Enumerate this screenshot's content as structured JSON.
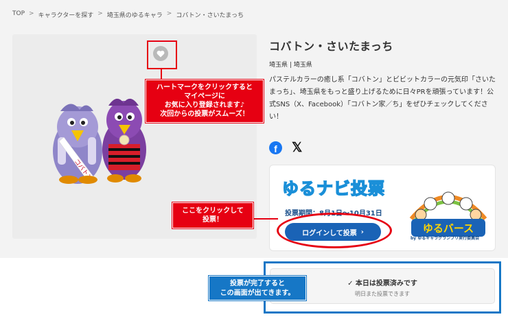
{
  "breadcrumb": [
    "TOP",
    "キャラクターを探す",
    "埼玉県のゆるキャラ",
    "コバトン・さいたまっち"
  ],
  "breadcrumb_separator": ">",
  "character": {
    "name": "コバトン・さいたまっち",
    "prefecture": "埼玉県 | 埼玉県",
    "description": "パステルカラーの癒し系「コバトン」とビビットカラーの元気印「さいたまっち」、埼玉県をもっと盛り上げるために日々PRを頑張っています！公式SNS（X、Facebook）「コバトン家／ち」をぜひチェックしてください！",
    "sash_text": "コバトン"
  },
  "social": {
    "facebook_icon": "facebook-icon",
    "x_icon": "x-icon",
    "facebook_glyph": "f",
    "x_glyph": "𝕏"
  },
  "banner": {
    "title": "ゆるナビ投票",
    "period": "投票期間：8月1日～10月31日",
    "login_button": "ログインして投票",
    "logo_text": "ゆるバース",
    "logo_caption": "by ゆるキャラグランプリ実行委員会"
  },
  "status": {
    "main": "✓ 本日は投票済みです",
    "sub": "明日また投票できます"
  },
  "annotations": {
    "heart": [
      "ハートマークをクリックすると",
      "マイページに",
      "お気に入り登録されます♪",
      "次回からの投票がスムーズ！"
    ],
    "vote": [
      "ここをクリックして",
      "投票！"
    ],
    "done": [
      "投票が完了すると",
      "この画面が出てきます。"
    ]
  },
  "colors": {
    "annotation_red": "#e60012",
    "annotation_blue": "#1677c6",
    "button_blue": "#1a63b6",
    "facebook": "#1877f2"
  }
}
